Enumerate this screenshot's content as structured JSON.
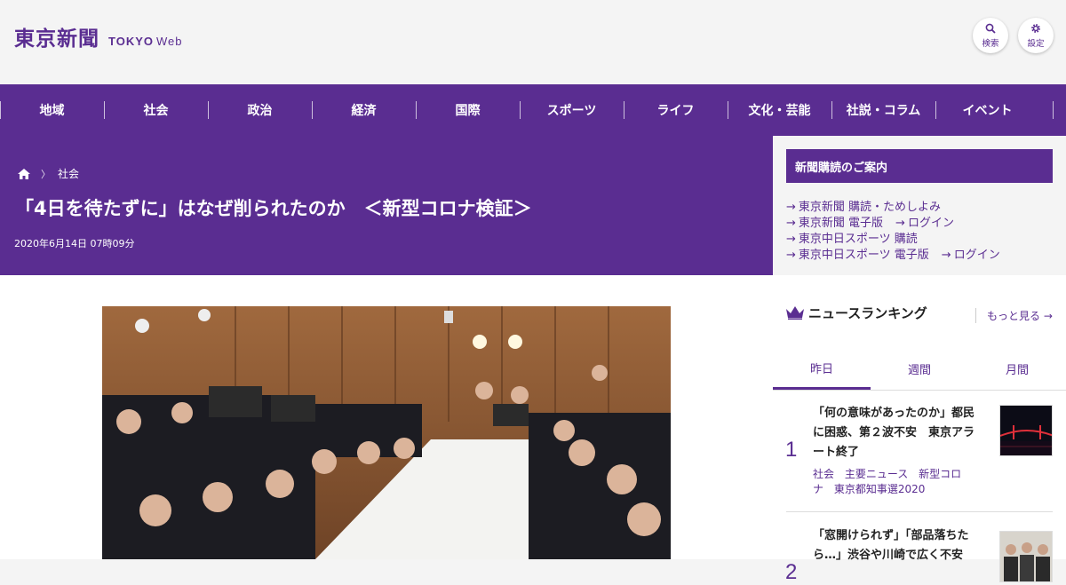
{
  "header": {
    "logo_jp": "東京新聞",
    "logo_en": "TOKYO",
    "logo_web": "Web",
    "search_label": "検索",
    "settings_label": "設定",
    "icons": {
      "search": "search-icon",
      "settings": "gear-icon"
    }
  },
  "nav": {
    "items": [
      "地域",
      "社会",
      "政治",
      "経済",
      "国際",
      "スポーツ",
      "ライフ",
      "文化・芸能",
      "社説・コラム",
      "イベント"
    ]
  },
  "article": {
    "breadcrumb_category": "社会",
    "title": "「4日を待たずに」はなぜ削られたのか　＜新型コロナ検証＞",
    "date": "2020年6月14日 07時09分"
  },
  "sidebar": {
    "subscription_heading": "新聞購読のご案内",
    "links": [
      [
        "東京新聞 購読・ためしよみ"
      ],
      [
        "東京新聞 電子版",
        "ログイン"
      ],
      [
        "東京中日スポーツ 購読"
      ],
      [
        "東京中日スポーツ 電子版",
        "ログイン"
      ]
    ],
    "ranking": {
      "title": "ニュースランキング",
      "more": "もっと見る",
      "tabs": [
        "昨日",
        "週間",
        "月間"
      ],
      "items": [
        {
          "rank": "1",
          "headline": "「何の意味があったのか」都民に困惑、第２波不安　東京アラート終了",
          "tags": [
            "社会",
            "主要ニュース",
            "新型コロナ",
            "東京都知事選2020"
          ]
        },
        {
          "rank": "2",
          "headline": "「窓開けられず」「部品落ちたら…」渋谷や川崎で広く不安",
          "tags": []
        }
      ]
    }
  },
  "colors": {
    "brand": "#5a2d91",
    "background": "#f4f4f4"
  }
}
